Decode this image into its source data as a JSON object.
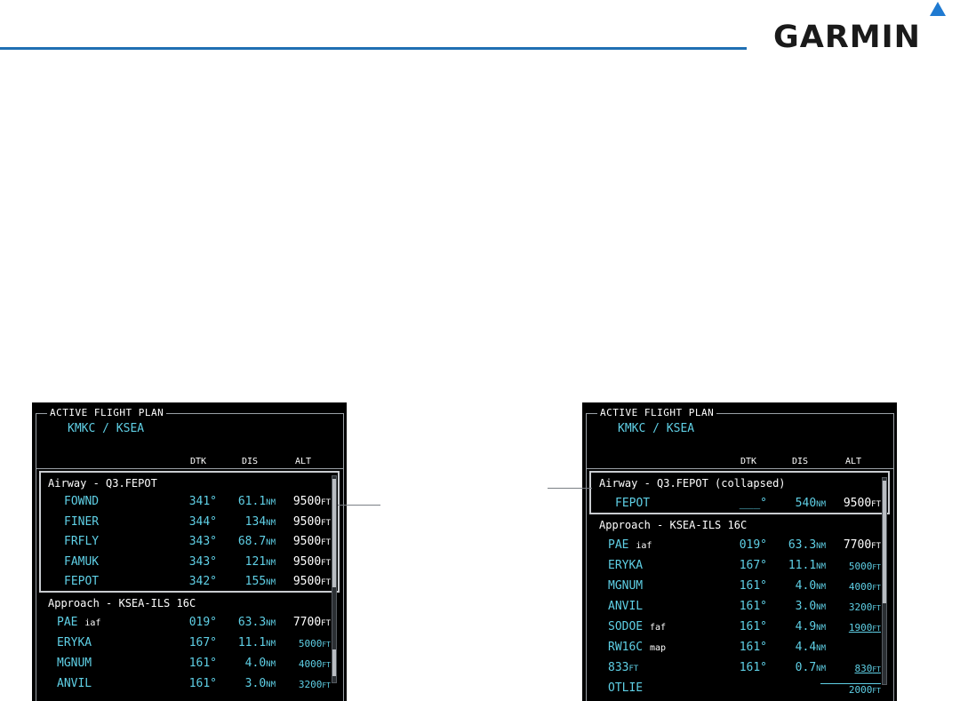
{
  "brand": {
    "logo_text": "GARMIN"
  },
  "left_panel": {
    "title": "ACTIVE FLIGHT PLAN",
    "route": "KMKC / KSEA",
    "columns": [
      "DTK",
      "DIS",
      "ALT"
    ],
    "airway": {
      "label": "Airway - Q3.FEPOT",
      "rows": [
        {
          "wpt": "FOWND",
          "dtk": "341°",
          "dis": "61.1",
          "dis_unit": "NM",
          "alt": "9500",
          "alt_unit": "FT"
        },
        {
          "wpt": "FINER",
          "dtk": "344°",
          "dis": "134",
          "dis_unit": "NM",
          "alt": "9500",
          "alt_unit": "FT"
        },
        {
          "wpt": "FRFLY",
          "dtk": "343°",
          "dis": "68.7",
          "dis_unit": "NM",
          "alt": "9500",
          "alt_unit": "FT"
        },
        {
          "wpt": "FAMUK",
          "dtk": "343°",
          "dis": "121",
          "dis_unit": "NM",
          "alt": "9500",
          "alt_unit": "FT"
        },
        {
          "wpt": "FEPOT",
          "dtk": "342°",
          "dis": "155",
          "dis_unit": "NM",
          "alt": "9500",
          "alt_unit": "FT"
        }
      ]
    },
    "approach": {
      "label": "Approach - KSEA-ILS 16C",
      "rows": [
        {
          "wpt": "PAE",
          "tag": "iaf",
          "dtk": "019°",
          "dis": "63.3",
          "dis_unit": "NM",
          "alt": "7700",
          "alt_unit": "FT"
        },
        {
          "wpt": "ERYKA",
          "tag": "",
          "dtk": "167°",
          "dis": "11.1",
          "dis_unit": "NM",
          "alt": "5000",
          "alt_unit": "FT"
        },
        {
          "wpt": "MGNUM",
          "tag": "",
          "dtk": "161°",
          "dis": "4.0",
          "dis_unit": "NM",
          "alt": "4000",
          "alt_unit": "FT"
        },
        {
          "wpt": "ANVIL",
          "tag": "",
          "dtk": "161°",
          "dis": "3.0",
          "dis_unit": "NM",
          "alt": "3200",
          "alt_unit": "FT"
        }
      ]
    }
  },
  "right_panel": {
    "title": "ACTIVE FLIGHT PLAN",
    "route": "KMKC / KSEA",
    "columns": [
      "DTK",
      "DIS",
      "ALT"
    ],
    "airway": {
      "label": "Airway - Q3.FEPOT (collapsed)",
      "rows": [
        {
          "wpt": "FEPOT",
          "dtk": "___°",
          "dis": "540",
          "dis_unit": "NM",
          "alt": "9500",
          "alt_unit": "FT"
        }
      ]
    },
    "approach": {
      "label": "Approach - KSEA-ILS 16C",
      "rows": [
        {
          "wpt": "PAE",
          "tag": "iaf",
          "dtk": "019°",
          "dis": "63.3",
          "dis_unit": "NM",
          "alt": "7700",
          "alt_unit": "FT"
        },
        {
          "wpt": "ERYKA",
          "tag": "",
          "dtk": "167°",
          "dis": "11.1",
          "dis_unit": "NM",
          "alt": "5000",
          "alt_unit": "FT"
        },
        {
          "wpt": "MGNUM",
          "tag": "",
          "dtk": "161°",
          "dis": "4.0",
          "dis_unit": "NM",
          "alt": "4000",
          "alt_unit": "FT"
        },
        {
          "wpt": "ANVIL",
          "tag": "",
          "dtk": "161°",
          "dis": "3.0",
          "dis_unit": "NM",
          "alt": "3200",
          "alt_unit": "FT"
        },
        {
          "wpt": "SODOE",
          "tag": "faf",
          "dtk": "161°",
          "dis": "4.9",
          "dis_unit": "NM",
          "alt": "1900",
          "alt_unit": "FT"
        },
        {
          "wpt": "RW16C",
          "tag": "map",
          "dtk": "161°",
          "dis": "4.4",
          "dis_unit": "NM",
          "alt": "",
          "alt_unit": ""
        },
        {
          "wpt": "833",
          "wpt_unit": "FT",
          "tag": "",
          "dtk": "161°",
          "dis": "0.7",
          "dis_unit": "NM",
          "alt": "830",
          "alt_unit": "FT"
        },
        {
          "wpt": "OTLIE",
          "tag": "",
          "dtk": "",
          "dis": "",
          "dis_unit": "",
          "alt": "2000",
          "alt_unit": "FT"
        }
      ]
    }
  },
  "colors": {
    "accent_blue": "#1f6fb3",
    "screen_bg": "#000000",
    "waypoint_cyan": "#5fd0e6",
    "text_white": "#ffffff"
  }
}
